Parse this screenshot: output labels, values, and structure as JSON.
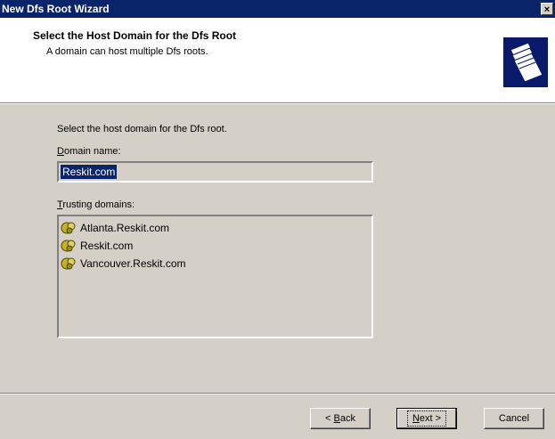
{
  "window": {
    "title": "New Dfs Root Wizard",
    "close_glyph": "×"
  },
  "header": {
    "title": "Select the Host Domain for the Dfs Root",
    "subtitle": "A domain can host multiple Dfs roots.",
    "icon": "folders-icon"
  },
  "body": {
    "instruction": "Select the host domain for the Dfs root.",
    "domain_label_accel": "D",
    "domain_label_rest": "omain name:",
    "domain_value": "Reskit.com",
    "trusting_label_accel": "T",
    "trusting_label_rest": "rusting domains:",
    "trusting_domains": [
      {
        "name": "Atlanta.Reskit.com",
        "icon": "domain-icon"
      },
      {
        "name": "Reskit.com",
        "icon": "domain-icon"
      },
      {
        "name": "Vancouver.Reskit.com",
        "icon": "domain-icon"
      }
    ]
  },
  "footer": {
    "back_prefix": "< ",
    "back_accel": "B",
    "back_rest": "ack",
    "next_accel": "N",
    "next_rest": "ext >",
    "cancel_label": "Cancel"
  },
  "colors": {
    "titlebar": "#0a246a",
    "dialog_face": "#d4d0c8",
    "selection": "#0a246a"
  }
}
